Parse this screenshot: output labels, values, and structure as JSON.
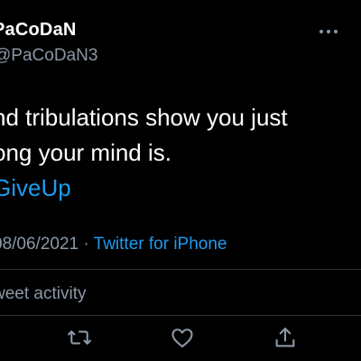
{
  "author": {
    "display_name": "PaCoDaN",
    "handle": "@PaCoDaN3"
  },
  "tweet": {
    "line1": "nd tribulations show you just",
    "line2": "ong your mind is.",
    "hashtag": "GiveUp"
  },
  "meta": {
    "date": "08/06/2021",
    "separator": " · ",
    "source": "Twitter for iPhone"
  },
  "activity_label": "weet activity",
  "icons": {
    "more": "more-horizontal-icon",
    "retweet": "retweet-icon",
    "like": "heart-icon",
    "share": "share-icon"
  },
  "colors": {
    "background": "#000000",
    "text": "#ffffff",
    "secondary": "#8b98a5",
    "link": "#1d9bf0",
    "divider": "#2f3336"
  }
}
